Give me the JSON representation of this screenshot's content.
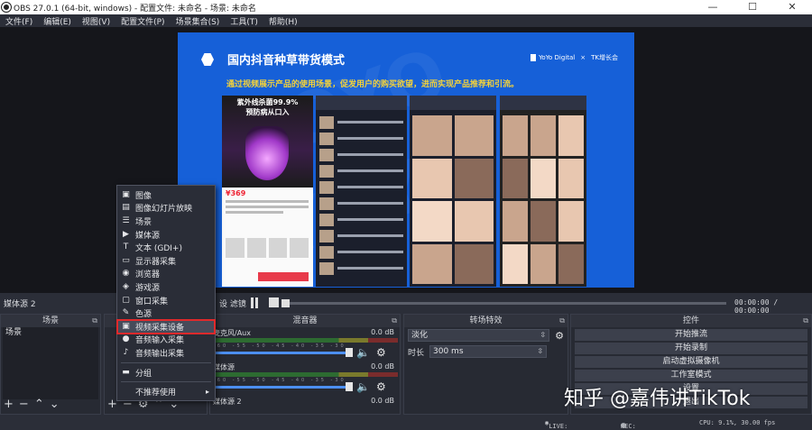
{
  "window": {
    "title": "OBS 27.0.1 (64-bit, windows) - 配置文件: 未命名 - 场景: 未命名",
    "minimize": "—",
    "maximize": "☐",
    "close": "✕"
  },
  "menubar": [
    "文件(F)",
    "编辑(E)",
    "视图(V)",
    "配置文件(P)",
    "场景集合(S)",
    "工具(T)",
    "帮助(H)"
  ],
  "slide": {
    "title": "国内抖音种草带货模式",
    "brand_left": "YoYo Digital",
    "brand_sep": "×",
    "brand_right": "TK增长会",
    "subtitle": "通过视频展示产品的使用场景，促发用户的购买欲望，进而实现产品推荐和引流。",
    "phone1_text": "紫外线杀菌99.9%\n预防病从口入",
    "phone1_price": "¥369"
  },
  "transport": {
    "source_tab": "媒体源 2",
    "settings": "设 滤镜",
    "time": "00:00:00 / 00:00:00"
  },
  "docks": {
    "scenes": {
      "title": "场景",
      "items": [
        "场景"
      ]
    },
    "sources": {
      "title": "来源"
    },
    "mixer": {
      "title": "混音器",
      "channels": [
        {
          "name": "麦克风/Aux",
          "db": "0.0 dB",
          "volume": 1.0
        },
        {
          "name": "媒体源",
          "db": "0.0 dB",
          "volume": 1.0
        },
        {
          "name": "媒体源 2",
          "db": "0.0 dB",
          "volume": 1.0
        }
      ],
      "ticks": "-60 -55 -50 -45 -40 -35 -30 -25 -20 -15 -10 -5 0"
    },
    "transitions": {
      "title": "转场特效",
      "selected": "淡化",
      "duration_label": "时长",
      "duration_value": "300 ms"
    },
    "controls": {
      "title": "控件",
      "buttons": [
        "开始推流",
        "开始录制",
        "启动虚拟摄像机",
        "工作室模式",
        "设置",
        "退出"
      ]
    }
  },
  "context_menu": {
    "items": [
      {
        "icon": "image-icon",
        "glyph": "▣",
        "label": "图像"
      },
      {
        "icon": "slideshow-icon",
        "glyph": "▤",
        "label": "图像幻灯片放映"
      },
      {
        "icon": "scene-icon",
        "glyph": "☰",
        "label": "场景"
      },
      {
        "icon": "media-icon",
        "glyph": "▶",
        "label": "媒体源"
      },
      {
        "icon": "text-icon",
        "glyph": "T",
        "label": "文本 (GDI+)"
      },
      {
        "icon": "monitor-icon",
        "glyph": "▭",
        "label": "显示器采集"
      },
      {
        "icon": "browser-icon",
        "glyph": "◉",
        "label": "浏览器"
      },
      {
        "icon": "game-icon",
        "glyph": "◈",
        "label": "游戏源"
      },
      {
        "icon": "window-icon",
        "glyph": "▢",
        "label": "窗口采集"
      },
      {
        "icon": "color-icon",
        "glyph": "✎",
        "label": "色源"
      },
      {
        "icon": "camera-icon",
        "glyph": "▣",
        "label": "视频采集设备",
        "highlighted": true
      },
      {
        "icon": "mic-icon",
        "glyph": "●",
        "label": "音频输入采集"
      },
      {
        "icon": "speaker-icon",
        "glyph": "♪",
        "label": "音频输出采集"
      }
    ],
    "group": {
      "icon": "folder-icon",
      "glyph": "▬",
      "label": "分组"
    },
    "deprecated": "不推荐使用"
  },
  "status": {
    "live": "LIVE: 00:00:00",
    "rec": "REC: 00:00:00",
    "cpu": "CPU: 9.1%, 30.00 fps"
  },
  "watermark": "知乎 @嘉伟讲TikTok",
  "colors": {
    "slide_bg": "#1660d8",
    "accent_yellow": "#f3d23b",
    "highlight_red": "#e0292b",
    "panel_bg": "#272a33"
  }
}
